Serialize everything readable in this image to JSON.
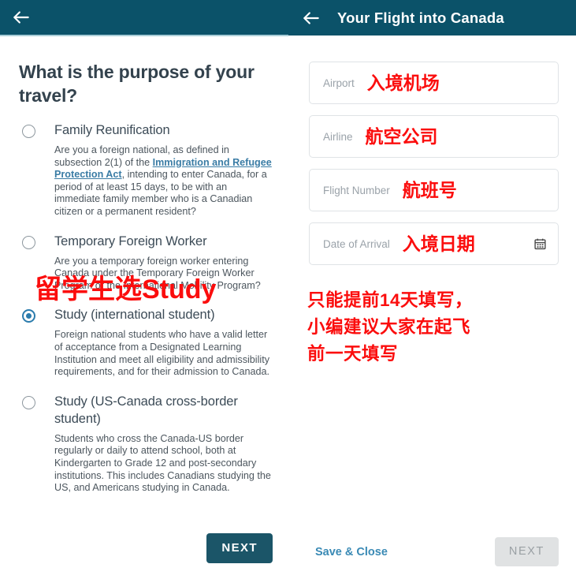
{
  "left_panel": {
    "appbar": {
      "back_icon": "back-arrow-icon"
    },
    "title": "What is the purpose of your travel?",
    "options": [
      {
        "label": "Family Reunification",
        "selected": false,
        "desc_part1": "Are you a foreign national, as defined in subsection 2(1) of the ",
        "link_text": "Immigration and Refugee Protection Act",
        "desc_part2": ", intending to enter Canada, for a period of at least 15 days, to be with an immediate family member who is a Canadian citizen or a permanent resident?"
      },
      {
        "label": "Temporary Foreign Worker",
        "selected": false,
        "desc_part1": "Are you a temporary foreign worker entering Canada under the Temporary Foreign Worker Program or the International Mobility Program?",
        "link_text": "",
        "desc_part2": ""
      },
      {
        "label": "Study (international student)",
        "selected": true,
        "desc_part1": "Foreign national students who have a valid letter of acceptance from a Designated Learning Institution and meet all eligibility and admissibility requirements, and for their admission to Canada.",
        "link_text": "",
        "desc_part2": ""
      },
      {
        "label": "Study (US-Canada cross-border student)",
        "selected": false,
        "desc_part1": "Students who cross the Canada-US border regularly or daily to attend school, both at Kindergarten to Grade 12 and post-secondary institutions. This includes Canadians studying the US, and Americans studying in Canada.",
        "link_text": "",
        "desc_part2": ""
      }
    ],
    "annotation": "留学生选Study",
    "next_label": "NEXT"
  },
  "right_panel": {
    "appbar": {
      "back_icon": "back-arrow-icon",
      "title": "Your Flight into Canada"
    },
    "fields": [
      {
        "label": "Airport",
        "annotation": "入境机场",
        "icon": ""
      },
      {
        "label": "Airline",
        "annotation": "航空公司",
        "icon": ""
      },
      {
        "label": "Flight Number",
        "annotation": "航班号",
        "icon": ""
      },
      {
        "label": "Date of Arrival",
        "annotation": "入境日期",
        "icon": "calendar-icon"
      }
    ],
    "note_line1": "只能提前14天填写，",
    "note_line2": "小编建议大家在起飞",
    "note_line3": "前一天填写",
    "save_close_label": "Save & Close",
    "next_label": "NEXT"
  },
  "colors": {
    "appbar": "#0b5269",
    "primary_button": "#1b5568",
    "annotation_red": "#fb0d0d",
    "link_blue": "#3a7ca5",
    "radio_selected": "#2b7cad",
    "disabled_button": "#e0e2e3"
  }
}
